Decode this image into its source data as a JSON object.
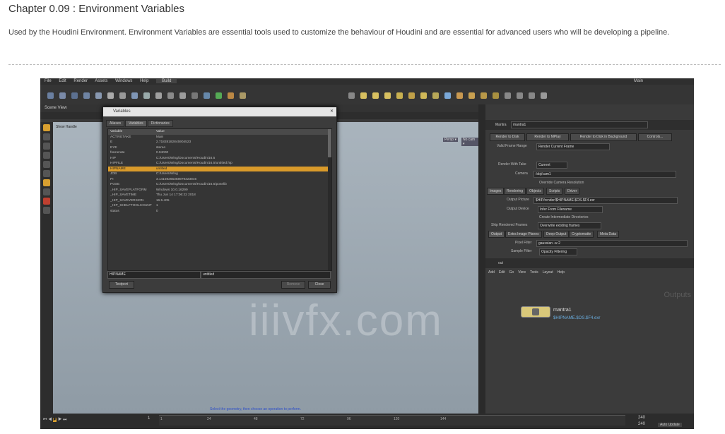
{
  "page": {
    "title": "Chapter 0.09 : Environment Variables",
    "intro": "Used by the Houdini Environment. Environment Variables are essential tools used to customize the behaviour of Houdini and are essential for advanced users who will be developing a pipeline."
  },
  "houdini": {
    "menu": [
      "File",
      "Edit",
      "Render",
      "Assets",
      "Windows",
      "Help"
    ],
    "build_label": "Build",
    "main_label": "Main",
    "viewport_label": "Scene View",
    "show_handle": "Show Handle",
    "persp_label": "Persp ▾",
    "cam_label": "No cam ▾",
    "status_message": "Select the geometry, then choose an operation to perform.",
    "dialog": {
      "title": "Variables",
      "tabs": [
        "Aliases",
        "Variables",
        "Dictionaries"
      ],
      "col_variable": "Variable",
      "col_value": "Value",
      "rows": [
        {
          "name": "ACTIVETAKE",
          "value": "Main"
        },
        {
          "name": "E",
          "value": "2.71828182845904523"
        },
        {
          "name": "EYE",
          "value": "stereo"
        },
        {
          "name": "framerate",
          "value": "0.04000"
        },
        {
          "name": "HIP",
          "value": "C:/Users/Wing/Documents/Houdini16.5"
        },
        {
          "name": "HIPFILE",
          "value": "C:/Users/Wing/Documents/Houdini16.5/untitled.hip"
        },
        {
          "name": "HIPNAME",
          "value": "untitled"
        },
        {
          "name": "JOB",
          "value": "C:/Users/Wing"
        },
        {
          "name": "PI",
          "value": "3.14159265358979323846"
        },
        {
          "name": "POSE",
          "value": "C:/Users/Wing/Documents/Houdini16.5/poselib"
        },
        {
          "name": "_HIP_SAVEPLATFORM",
          "value": "Windows 10.0.16299"
        },
        {
          "name": "_HIP_SAVETIME",
          "value": "Thu Jun 14 17:06:22 2018"
        },
        {
          "name": "_HIP_SAVEVERSION",
          "value": "16.5.405"
        },
        {
          "name": "_HIP_SHELFTOOLCOUNT",
          "value": "1"
        },
        {
          "name": "status",
          "value": "0"
        }
      ],
      "selected_index": 6,
      "edit_name": "HIPNAME",
      "edit_value": "untitled",
      "textport_button": "Textport",
      "remove_button": "Remove",
      "close_button": "Close"
    },
    "params": {
      "node_type": "Mantra",
      "node_name": "mantra1",
      "buttons": [
        "Render to Disk",
        "Render to MPlay",
        "Render to Disk in Background",
        "Controls..."
      ],
      "valid_frame_range_label": "Valid Frame Range",
      "valid_frame_range_value": "Render Current Frame",
      "render_with_take_label": "Render With Take",
      "render_with_take_value": "Current",
      "camera_label": "Camera",
      "camera_value": "/obj/cam1",
      "override_cam": "Override Camera Resolution",
      "tabs": [
        "Images",
        "Rendering",
        "Objects",
        "Scripts",
        "Driver"
      ],
      "output_picture_label": "Output Picture",
      "output_picture_value": "$HIP/render/$HIPNAME.$OS.$F4.exr",
      "output_device_label": "Output Device",
      "output_device_value": "Infer From Filename",
      "create_dirs": "Create Intermediate Directories",
      "skip_rendered_label": "Skip Rendered Frames",
      "skip_rendered_value": "Overwrite existing frames",
      "subtabs": [
        "Output",
        "Extra Image Planes",
        "Deep Output",
        "Cryptomatte",
        "Meta Data"
      ],
      "pixel_filter_label": "Pixel Filter",
      "pixel_filter_value": "gaussian -w 2",
      "sample_filter_label": "Sample Filter",
      "sample_filter_value": "Opacity Filtering"
    },
    "network": {
      "path": "out",
      "menu": [
        "Add",
        "Edit",
        "Go",
        "View",
        "Tools",
        "Layout",
        "Help"
      ],
      "context_label": "Outputs",
      "node_name": "mantra1",
      "node_output": "$HIPNAME.$OS.$F4.exr"
    },
    "timeline": {
      "ticks": [
        "1",
        "24",
        "48",
        "72",
        "96",
        "120",
        "144"
      ],
      "end_frame": "240",
      "end_frame2": "240",
      "current_frame": "1",
      "auto_update": "Auto Update"
    }
  }
}
